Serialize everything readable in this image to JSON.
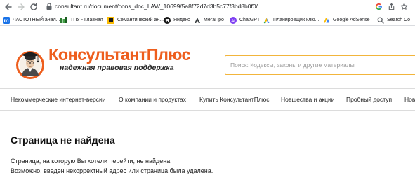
{
  "browser": {
    "url": "consultant.ru/document/cons_doc_LAW_10699/5a8f72d7d3b5c77f3bd8b0f0/"
  },
  "bookmarks": [
    {
      "label": "ЧАСТОТНЫЙ анал...",
      "icon": "bookmark-m-icon",
      "color": "#1a73e8"
    },
    {
      "label": "ТПУ - Главная",
      "icon": "bookmark-tpu-icon",
      "color": "#2e7d32"
    },
    {
      "label": "Семантический ан...",
      "icon": "bookmark-semantic-icon",
      "color": "#fbbc04"
    },
    {
      "label": "Яндекс",
      "icon": "bookmark-yandex-icon",
      "color": "#fc3f1d"
    },
    {
      "label": "МегаПро",
      "icon": "bookmark-megapro-icon",
      "color": "#1a1a1a"
    },
    {
      "label": "ChatGPT",
      "icon": "bookmark-chatgpt-icon",
      "color": "#7e3ff2"
    },
    {
      "label": "Планировщик клю...",
      "icon": "bookmark-keyword-planner-icon",
      "color": "#4285f4"
    },
    {
      "label": "Google AdSense",
      "icon": "bookmark-adsense-icon",
      "color": "#fbbc04"
    },
    {
      "label": "Search Co",
      "icon": "bookmark-search-console-icon",
      "color": "#4285f4"
    }
  ],
  "site": {
    "brand_name": "КонсультантПлюс",
    "tagline": "надежная правовая поддержка",
    "brand_color": "#ee5e1d",
    "search_placeholder": "Поиск: Кодексы, законы и другие материалы",
    "search_border_color": "#f2b53c",
    "nav": [
      "Некоммерческие интернет-версии",
      "О компании и продуктах",
      "Купить КонсультантПлюс",
      "Новшества и акции",
      "Пробный доступ",
      "Нов"
    ]
  },
  "content": {
    "title": "Страница не найдена",
    "line1": "Страница, на которую Вы хотели перейти, не найдена.",
    "line2": "Возможно, введен некорректный адрес или страница была удалена."
  }
}
